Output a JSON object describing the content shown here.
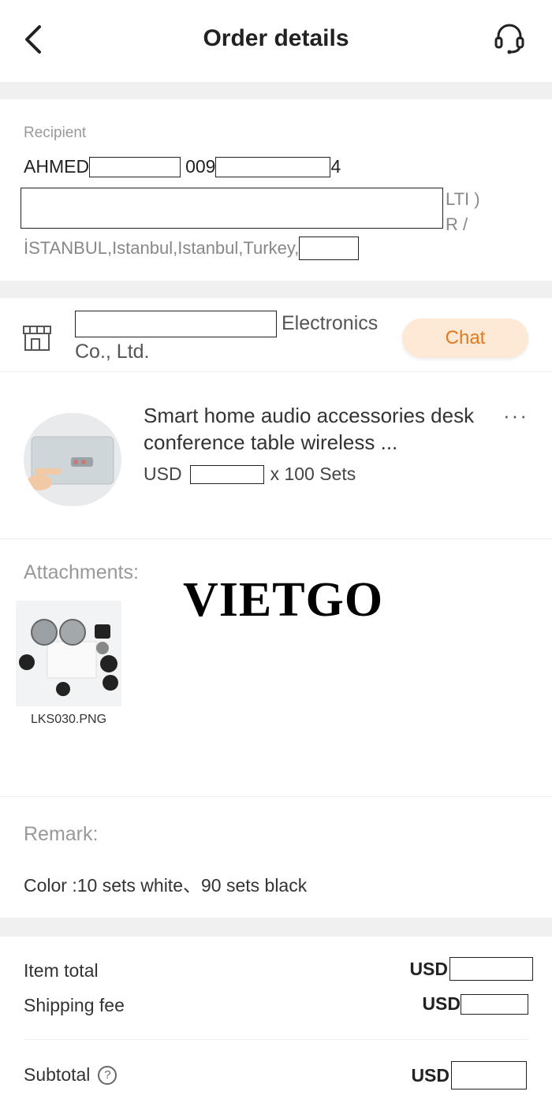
{
  "header": {
    "title": "Order details",
    "back_icon": "chevron-left-icon",
    "support_icon": "headset-icon"
  },
  "recipient": {
    "label": "Recipient",
    "name": "AHMED",
    "phone_prefix": "009",
    "phone_suffix": "4",
    "address_line1_fragment": "LTI )",
    "address_line2_fragment": "R /",
    "address_line3": "İSTANBUL,Istanbul,Istanbul,Turkey,"
  },
  "seller": {
    "name_suffix": "Electronics",
    "name_line2": "Co., Ltd.",
    "chat_label": "Chat",
    "shop_icon": "storefront-icon"
  },
  "product": {
    "title": "Smart home audio accessories desk conference table wireless ...",
    "price_currency": "USD",
    "quantity": "x 100 Sets",
    "more_label": "···"
  },
  "attachments": {
    "label": "Attachments:",
    "watermark": "VIETGO",
    "file_name": "LKS030.PNG"
  },
  "remark": {
    "label": "Remark:",
    "text": "Color :10 sets  white、90 sets  black"
  },
  "totals": {
    "item_total_label": "Item total",
    "item_total_currency": "USD",
    "shipping_label": "Shipping fee",
    "shipping_currency": "USD",
    "subtotal_label": "Subtotal",
    "subtotal_currency": "USD",
    "help_symbol": "?"
  },
  "colors": {
    "chat_bg": "#fde9d6",
    "chat_text": "#e07a1c",
    "divider": "#f0f0f0"
  }
}
